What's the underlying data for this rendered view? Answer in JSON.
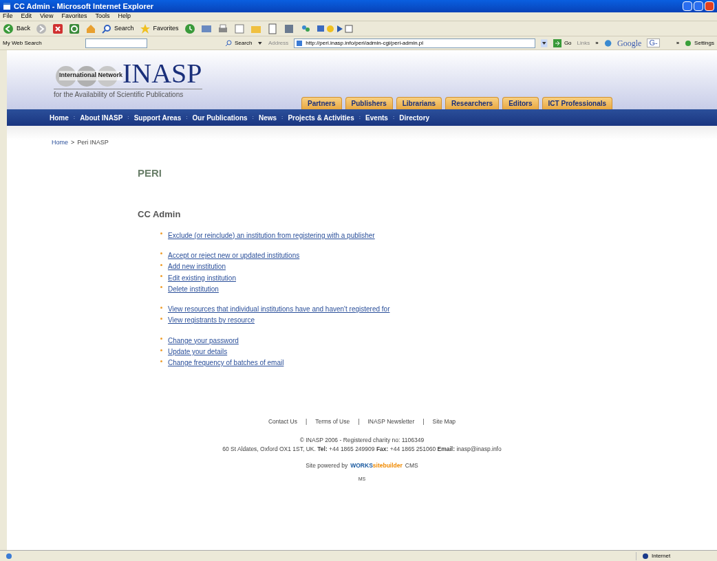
{
  "window": {
    "title": "CC Admin - Microsoft Internet Explorer"
  },
  "menu": [
    "File",
    "Edit",
    "View",
    "Favorites",
    "Tools",
    "Help"
  ],
  "toolbar": {
    "back": "Back",
    "search": "Search",
    "favorites": "Favorites"
  },
  "address_bar": {
    "web_search_label": "My Web Search",
    "search_button": "Search",
    "address_label": "Address",
    "url": "http://peri.inasp.info/peri/admin-cgi/peri-admin.pl",
    "go": "Go",
    "links": "Links",
    "chevron": "»",
    "google": "Google",
    "google_button": "G-",
    "chevron_2": "»",
    "settings": "Settings"
  },
  "site": {
    "logo": "INASP",
    "logo_caption": "International Network",
    "tagline": "for the Availability of Scientific Publications",
    "audience_tabs": [
      "Partners",
      "Publishers",
      "Librarians",
      "Researchers",
      "Editors",
      "ICT Professionals"
    ],
    "nav_separator": ":",
    "nav": [
      "Home",
      "About INASP",
      "Support Areas",
      "Our Publications",
      "News",
      "Projects & Activities",
      "Events",
      "Directory"
    ],
    "breadcrumb": [
      "Home",
      "Peri INASP"
    ],
    "breadcrumb_separator": ">",
    "page_title": "PERI",
    "section_title": "CC Admin",
    "link_groups": [
      [
        "Exclude (or reinclude) an institution from registering with a publisher"
      ],
      [
        "Accept or reject new or updated institutions",
        "Add new institution",
        "Edit existing institution",
        "Delete institution"
      ],
      [
        "View resources that individual institutions have and haven't registered for",
        "View registrants by resource"
      ],
      [
        "Change your password",
        "Update your details",
        "Change frequency of batches of email"
      ]
    ],
    "footer": {
      "separator": "|",
      "links": [
        "Contact Us",
        "Terms of Use",
        "INASP Newsletter",
        "Site Map"
      ],
      "copyright": "© INASP 2006 - Registered charity no: 1106349",
      "address": "60 St Aldates, Oxford OX1 1ST, UK. **Tel:** +44 1865 249909 **Fax:** +44 1865 251060 **Email:** inasp@inasp.info",
      "powered_by": "Site powered by",
      "cms_brand_1": "WORKS",
      "cms_brand_2": "sitebuilder",
      "cms": "CMS",
      "initials": "MS"
    }
  },
  "status_bar": {
    "zone": "Internet"
  }
}
